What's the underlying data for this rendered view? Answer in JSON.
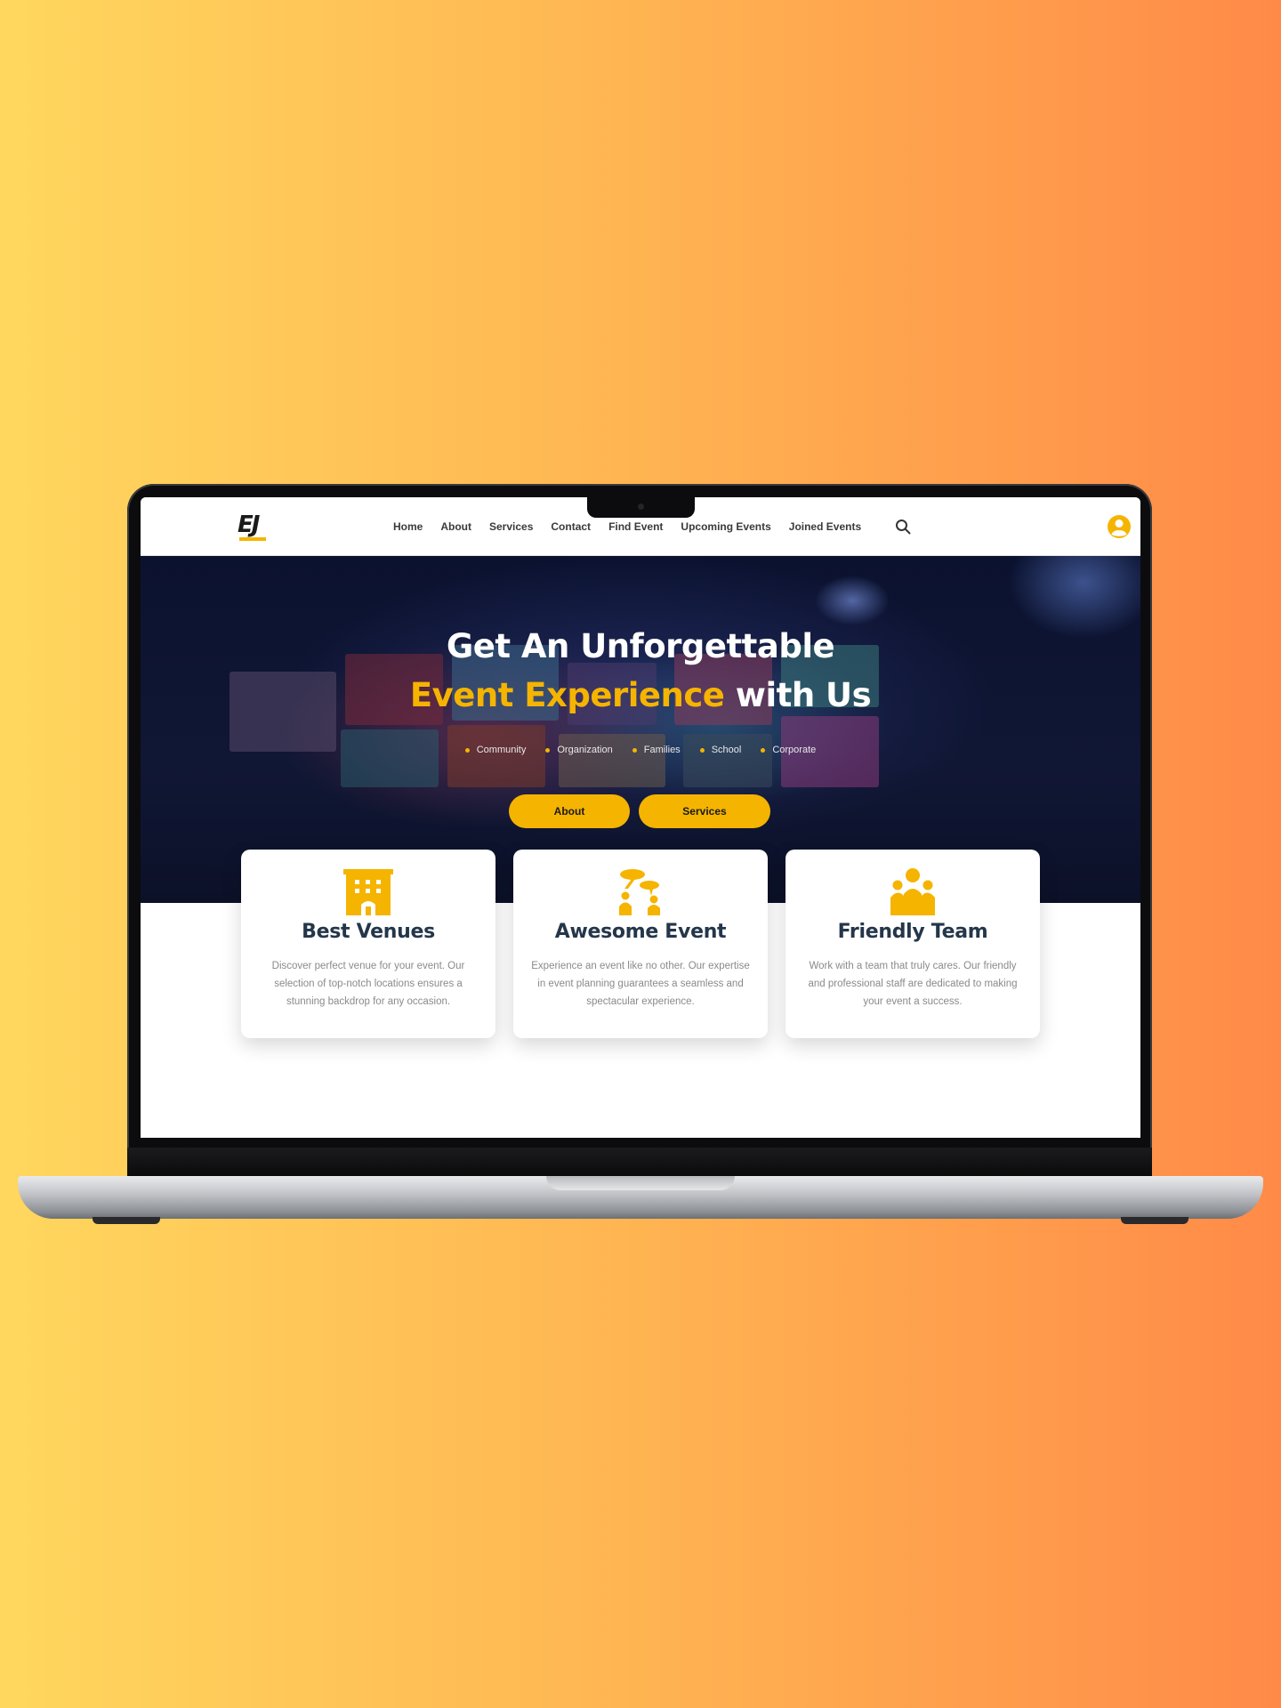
{
  "navbar": {
    "logo_text": "EJ",
    "links": [
      "Home",
      "About",
      "Services",
      "Contact",
      "Find Event",
      "Upcoming Events",
      "Joined Events"
    ],
    "icons": [
      "search-icon",
      "account-icon"
    ]
  },
  "hero": {
    "title_line1": "Get An Unforgettable",
    "title_line2_highlight": "Event Experience",
    "title_line2_rest": " with Us",
    "categories": [
      "Community",
      "Organization",
      "Families",
      "School",
      "Corporate"
    ],
    "buttons": {
      "about": "About",
      "services": "Services"
    }
  },
  "features": [
    {
      "title": "Best Venues",
      "icon": "building-icon",
      "text": "Discover perfect venue for your event. Our selection of top-notch locations ensures a stunning backdrop for any occasion."
    },
    {
      "title": "Awesome Event",
      "icon": "people-event-icon",
      "text": "Experience an event like no other. Our expertise in event planning guarantees a seamless and spectacular experience."
    },
    {
      "title": "Friendly Team",
      "icon": "team-icon",
      "text": "Work with a team that truly cares. Our friendly and professional staff are dedicated to making your event a success."
    }
  ],
  "colors": {
    "accent": "#f5b400",
    "heading": "#24364a",
    "hero_bg": "#0b1230",
    "page_bg_left": "#ffd75e",
    "page_bg_right": "#ff8a48"
  }
}
